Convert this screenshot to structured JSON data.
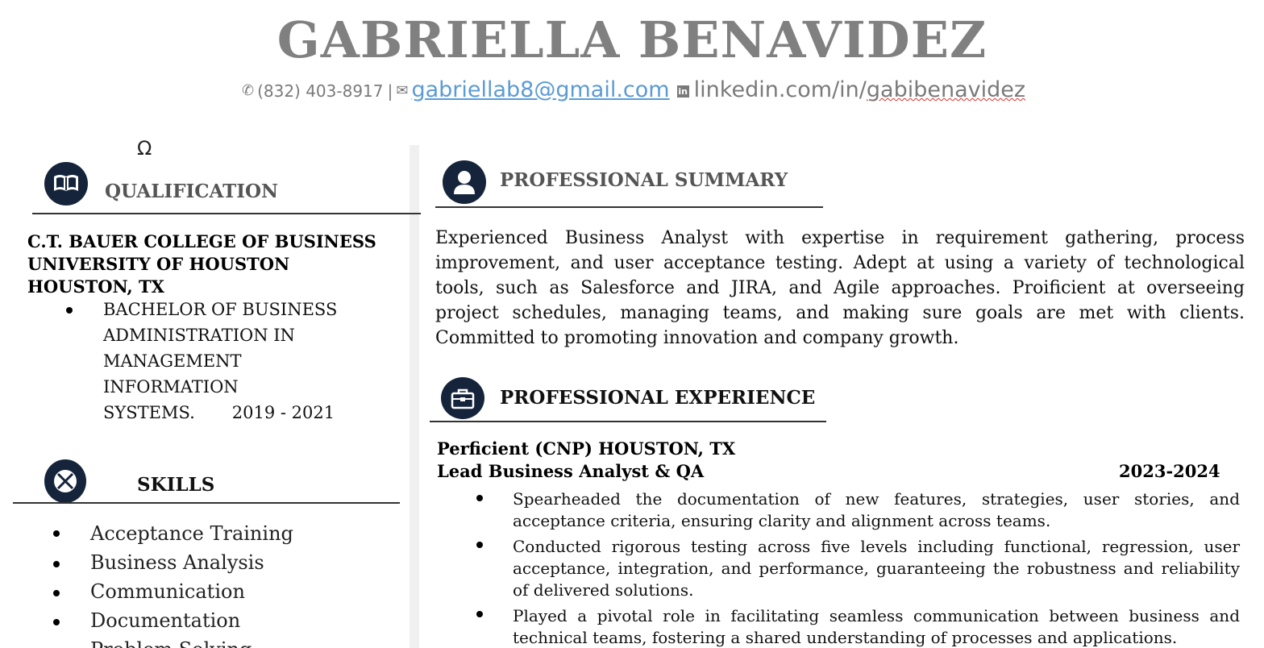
{
  "header": {
    "name": "GABRIELLA BENAVIDEZ",
    "phone": "(832) 403-8917",
    "separator": "|",
    "email": "gabriellab8@gmail.com",
    "linkedin_prefix": "linkedin.com/in/",
    "linkedin_handle": "gabibenavidez"
  },
  "stray_symbol": "Ω",
  "qualification": {
    "title": "QUALIFICATION",
    "school_line1": "C.T. BAUER COLLEGE OF BUSINESS",
    "school_line2": "UNIVERSITY OF HOUSTON",
    "school_line3": "HOUSTON, TX",
    "degree_line1": "BACHELOR OF BUSINESS",
    "degree_line2": "ADMINISTRATION IN",
    "degree_line3": "MANAGEMENT INFORMATION",
    "degree_line4": "SYSTEMS.",
    "degree_years": "2019 - 2021"
  },
  "skills": {
    "title": "SKILLS",
    "items": [
      "Acceptance Training",
      "Business Analysis",
      "Communication",
      "Documentation",
      "Problem Solving"
    ]
  },
  "summary": {
    "title": "PROFESSIONAL SUMMARY",
    "text": "Experienced Business Analyst with expertise in requirement gathering, process improvement, and user acceptance testing. Adept at using a variety of technological tools, such as Salesforce and JIRA, and Agile approaches. Proificient  at overseeing project schedules, managing teams, and making sure goals are met with clients. Committed to promoting innovation and company growth."
  },
  "experience": {
    "title": "PROFESSIONAL EXPERIENCE",
    "company": "Perficient (CNP) HOUSTON, TX",
    "role": "Lead Business Analyst & QA",
    "dates": "2023-2024",
    "bullets": [
      "Spearheaded the documentation of new features, strategies, user stories, and acceptance criteria, ensuring clarity and alignment across teams.",
      "Conducted rigorous testing across five levels including functional, regression, user acceptance, integration, and performance, guaranteeing the robustness and reliability of delivered solutions.",
      "Played a pivotal role in facilitating seamless communication between business and technical teams, fostering a shared understanding of processes and applications."
    ]
  },
  "icons": {
    "phone": "phone-icon",
    "email": "envelope-icon",
    "linkedin": "linkedin-icon",
    "qualification": "book-icon",
    "skills": "cross-circle-icon",
    "summary": "person-icon",
    "experience": "briefcase-icon"
  },
  "colors": {
    "name": "#808080",
    "icon_circle": "#15243a",
    "email_link": "#5b9bd5",
    "spellcheck": "#d9302b"
  }
}
